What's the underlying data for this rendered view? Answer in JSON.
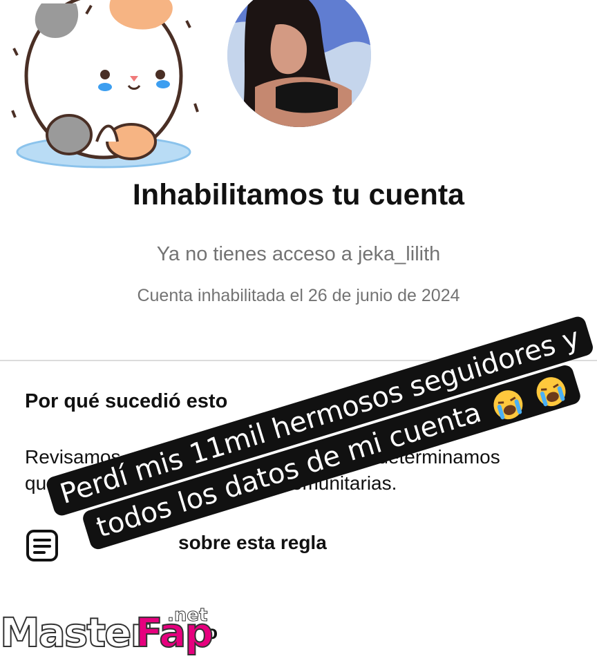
{
  "profile": {
    "title": "Inhabilitamos tu cuenta",
    "access_text": "Ya no tienes acceso a jeka_lilith",
    "disabled_date": "Cuenta inhabilitada el 26 de junio de 2024"
  },
  "reason": {
    "heading": "Por qué sucedió esto",
    "body_line1": "Revisamos                                          e y determinamos",
    "body_line2": "qu                                       as comunitarias.",
    "rule_link": "sobre esta regla",
    "bottom_link": "o"
  },
  "overlay": {
    "line1": "Perdí mis 11mil hermosos seguidores y",
    "line2": "todos los datos de mi cuenta"
  },
  "watermark": {
    "part1": "Master",
    "part2": "Fap",
    "suffix": ".net"
  }
}
